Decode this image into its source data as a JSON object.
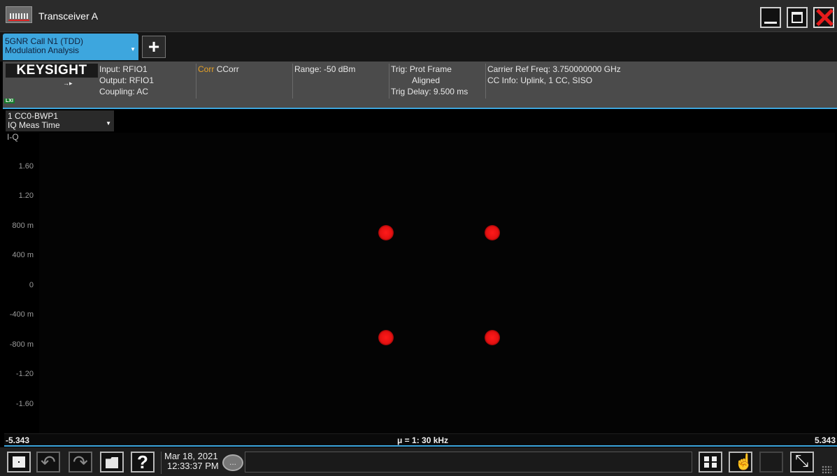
{
  "window": {
    "title": "Transceiver A"
  },
  "mode_tab": {
    "line1": "5GNR Call N1 (TDD)",
    "line2": "Modulation Analysis",
    "add_label": "+"
  },
  "settings": {
    "brand": "KEYSIGHT",
    "lxi": "LXI",
    "input": "Input: RFIO1",
    "output": "Output: RFIO1",
    "coupling": "Coupling: AC",
    "corr_prefix": "Corr",
    "corr_value": "CCorr",
    "range": "Range: -50 dBm",
    "trig": "Trig: Prot Frame",
    "trig_aligned": "Aligned",
    "trig_delay": "Trig Delay: 9.500 ms",
    "carrier_ref_freq": "Carrier Ref Freq: 3.750000000 GHz",
    "cc_info": "CC Info: Uplink, 1 CC, SISO"
  },
  "trace_window": {
    "line1": "1 CC0-BWP1",
    "line2": "IQ Meas Time",
    "plot_label": "I-Q"
  },
  "y_ticks": [
    "1.60",
    "1.20",
    "800 m",
    "400 m",
    "0",
    "-400 m",
    "-800 m",
    "-1.20",
    "-1.60"
  ],
  "x_axis": {
    "left": "-5.343",
    "center": "μ = 1: 30 kHz",
    "right": "5.343"
  },
  "constellation": {
    "points_color": "#e41111",
    "points": [
      {
        "i": -0.71,
        "q": 0.71
      },
      {
        "i": 0.71,
        "q": 0.71
      },
      {
        "i": -0.71,
        "q": -0.71
      },
      {
        "i": 0.71,
        "q": -0.71
      }
    ]
  },
  "taskbar": {
    "date": "Mar 18, 2021",
    "time": "12:33:37 PM",
    "help_label": "?",
    "msg_label": "..."
  },
  "accent_color": "#3da6de"
}
